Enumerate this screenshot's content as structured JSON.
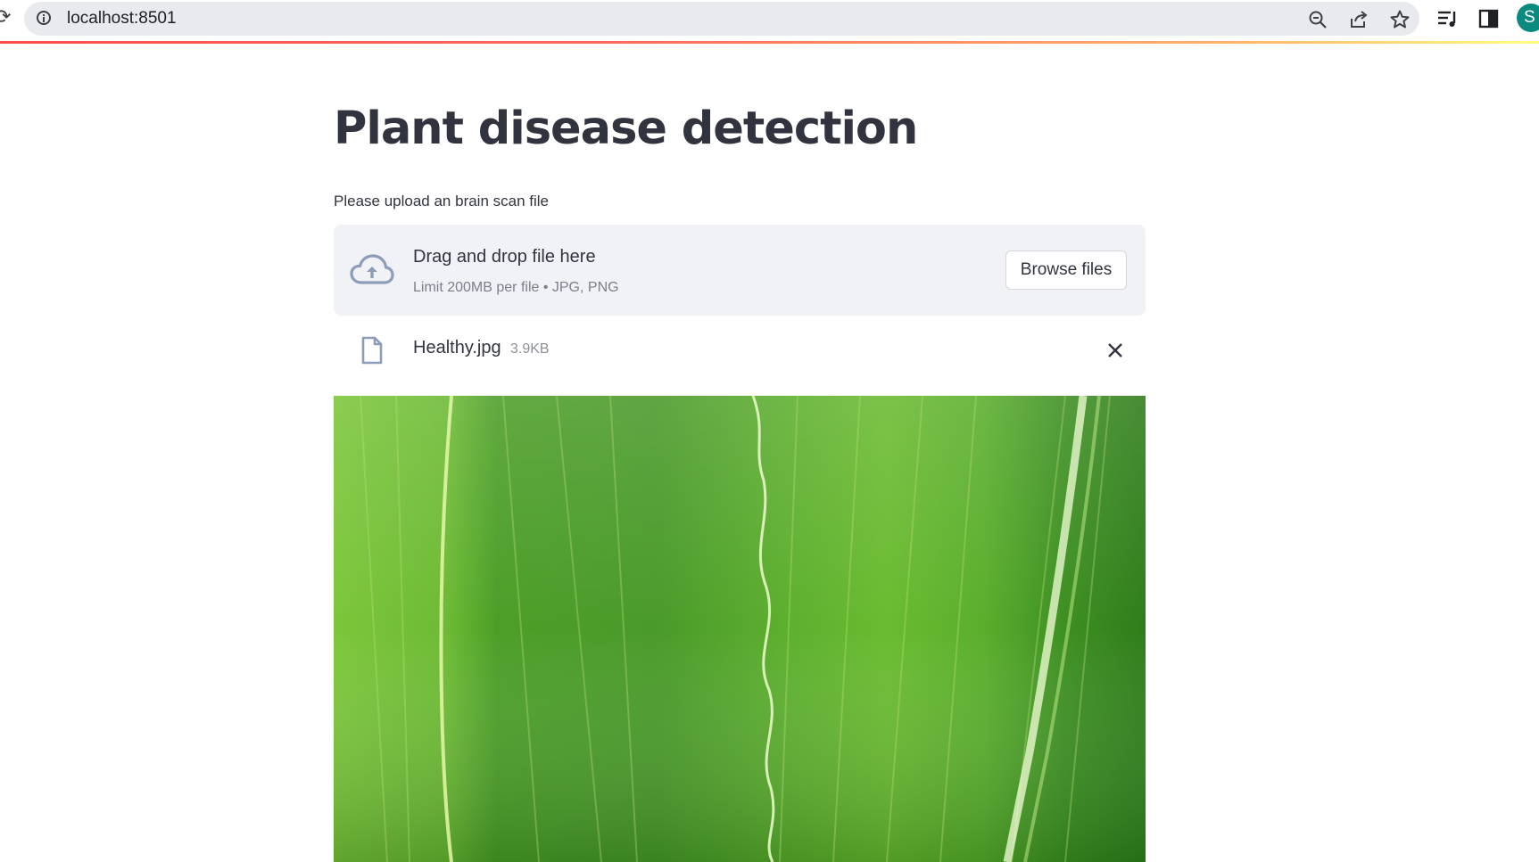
{
  "browser": {
    "url": "localhost:8501",
    "profile_initial": "S",
    "icons": [
      "reload-icon",
      "site-info-icon",
      "zoom-out-icon",
      "share-icon",
      "bookmark-star-icon",
      "reading-list-icon",
      "side-panel-icon"
    ]
  },
  "page": {
    "title": "Plant disease detection",
    "uploader_label": "Please upload an brain scan file"
  },
  "uploader": {
    "drop_title": "Drag and drop file here",
    "limit_text": "Limit 200MB per file • JPG, PNG",
    "browse_label": "Browse files",
    "icon": "cloud-upload-icon"
  },
  "uploaded_file": {
    "name": "Healthy.jpg",
    "size": "3.9KB",
    "icon": "file-icon",
    "remove_icon": "close-icon"
  },
  "colors": {
    "accent": "#ff4b4b",
    "dropzone_bg": "#f0f2f6",
    "text": "#31333f",
    "profile": "#0b8a7e"
  }
}
